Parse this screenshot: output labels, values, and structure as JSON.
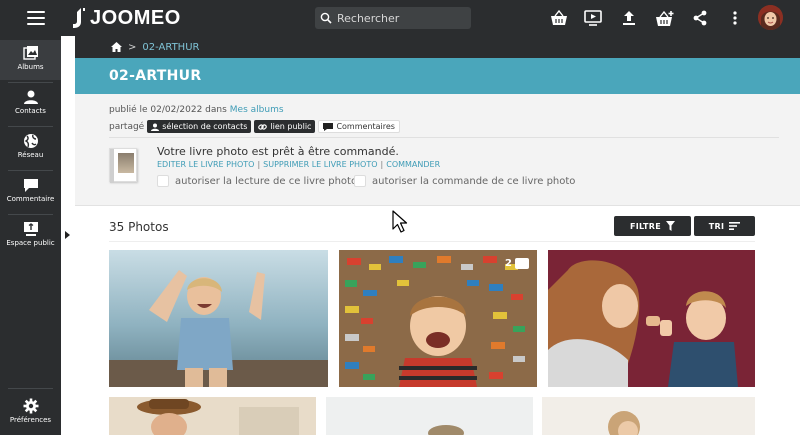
{
  "app": {
    "name": "JOOMEO"
  },
  "search": {
    "placeholder": "Rechercher"
  },
  "topbar": {
    "icons": [
      "basket-icon",
      "slideshow-icon",
      "upload-icon",
      "basket-add-icon",
      "share-icon",
      "more-vertical-icon",
      "avatar"
    ]
  },
  "sidebar": {
    "items": [
      {
        "label": "Albums",
        "icon": "albums-icon"
      },
      {
        "label": "Contacts",
        "icon": "contacts-icon"
      },
      {
        "label": "Réseau",
        "icon": "network-icon"
      },
      {
        "label": "Commentaire",
        "icon": "comment-icon"
      },
      {
        "label": "Espace public",
        "icon": "public-space-icon"
      }
    ],
    "footer": {
      "label": "Préférences",
      "icon": "gear-icon"
    }
  },
  "breadcrumb": {
    "home_icon": "home-icon",
    "separator": ">",
    "current": "02-ARTHUR"
  },
  "page": {
    "title": "02-ARTHUR"
  },
  "info": {
    "published_prefix": "publié le 02/02/2022 dans",
    "published_album": "Mes albums",
    "shared_label": "partagé",
    "tags": [
      "sélection de contacts",
      "lien public",
      "Commentaires"
    ]
  },
  "photobook": {
    "title": "Votre livre photo est prêt à être commandé.",
    "actions": [
      "EDITER LE LIVRE PHOTO",
      "SUPPRIMER LE LIVRE PHOTO",
      "COMMANDER"
    ],
    "checkbox_read": "autoriser la lecture de ce livre photo",
    "checkbox_order": "autoriser la commande de ce livre photo"
  },
  "photos": {
    "count_label": "35 Photos",
    "filter_label": "FILTRE",
    "sort_label": "TRI",
    "badge_count": "2"
  },
  "colors": {
    "dark": "#2b2d2f",
    "accent": "#4aa6bb",
    "link": "#3f9cb6",
    "panel": "#f3f3f3"
  }
}
